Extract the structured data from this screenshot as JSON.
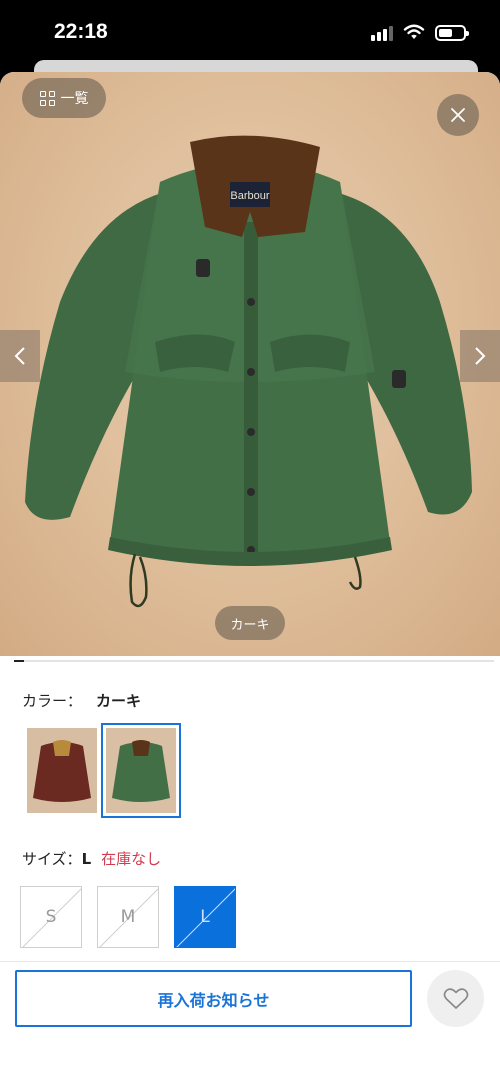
{
  "status_bar": {
    "time": "22:18"
  },
  "gallery": {
    "list_button_label": "一覧",
    "color_chip": "カーキ",
    "progress_fraction": 0.02
  },
  "color": {
    "label": "カラー：",
    "value": "カーキ",
    "selected_index": 1
  },
  "size": {
    "label": "サイズ：",
    "value": "L",
    "stock_status": "在庫なし",
    "options": [
      "S",
      "M",
      "L"
    ],
    "selected_index": 2
  },
  "actions": {
    "restock_label": "再入荷お知らせ"
  },
  "colors": {
    "accent": "#1a73d6",
    "stock_warning": "#d23a4e"
  },
  "icons": [
    "grid-icon",
    "close-icon",
    "chevron-left-icon",
    "chevron-right-icon",
    "heart-icon",
    "wifi-icon",
    "battery-icon",
    "signal-icon"
  ]
}
